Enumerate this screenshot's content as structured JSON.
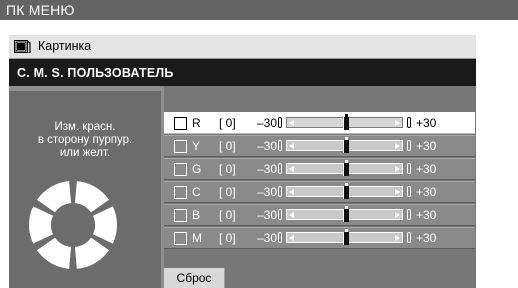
{
  "menu": {
    "title": "ПК МЕНЮ"
  },
  "panel": {
    "header_title": "Картинка",
    "section_title": "C. M. S. ПОЛЬЗОВАТЕЛЬ"
  },
  "hint": {
    "lines": [
      "Изм. красн.",
      "в сторону пурпур.",
      "или желт."
    ]
  },
  "rows": [
    {
      "label": "R",
      "value": "[ 0]",
      "min": "–30",
      "max": "+30",
      "level": 0.5,
      "selected": true
    },
    {
      "label": "Y",
      "value": "[ 0]",
      "min": "–30",
      "max": "+30",
      "level": 0.5,
      "selected": false
    },
    {
      "label": "G",
      "value": "[ 0]",
      "min": "–30",
      "max": "+30",
      "level": 0.5,
      "selected": false
    },
    {
      "label": "C",
      "value": "[ 0]",
      "min": "–30",
      "max": "+30",
      "level": 0.5,
      "selected": false
    },
    {
      "label": "B",
      "value": "[ 0]",
      "min": "–30",
      "max": "+30",
      "level": 0.5,
      "selected": false
    },
    {
      "label": "M",
      "value": "[ 0]",
      "min": "–30",
      "max": "+30",
      "level": 0.5,
      "selected": false
    }
  ],
  "reset": {
    "label": "Сброс"
  },
  "colors": {
    "menu_bar": "#636363",
    "panel_bg": "#6e6e6e",
    "section_bar": "#1a1a1a",
    "row_bg": "#8a8a8a",
    "row_selected_bg": "#ffffff"
  },
  "icons": {
    "header": "picture-icon",
    "wheel": "color-wheel-icon"
  }
}
